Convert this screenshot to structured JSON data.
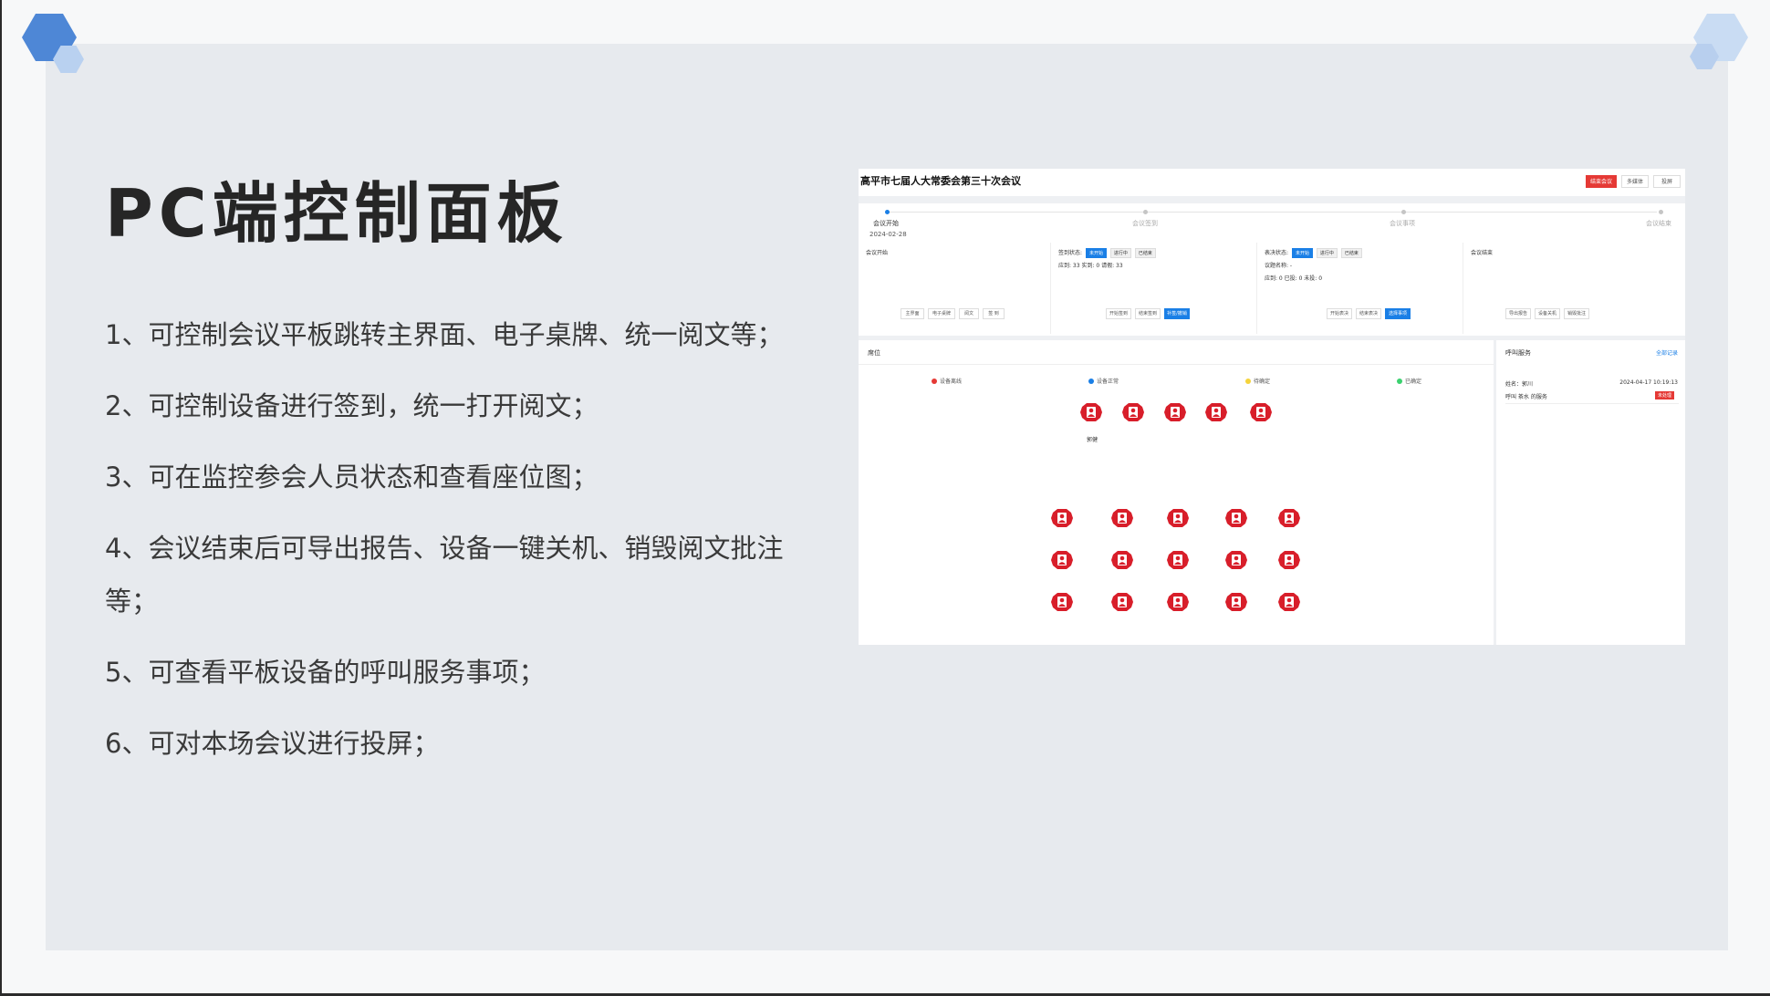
{
  "slide": {
    "title": "PC端控制面板",
    "bullets": [
      "1、可控制会议平板跳转主界面、电子桌牌、统一阅文等；",
      "2、可控制设备进行签到，统一打开阅文；",
      "3、可在监控参会人员状态和查看座位图；",
      "4、会议结束后可导出报告、设备一键关机、销毁阅文批注等；",
      "5、可查看平板设备的呼叫服务事项；",
      "6、可对本场会议进行投屏；"
    ]
  },
  "screenshot": {
    "meeting_title": "高平市七届人大常委会第三十次会议",
    "header_buttons": [
      "结束会议",
      "多媒体",
      "投屏"
    ],
    "steps": [
      {
        "label": "会议开始",
        "active": true
      },
      {
        "label": "会议签到",
        "active": false
      },
      {
        "label": "会议事项",
        "active": false
      },
      {
        "label": "会议结束",
        "active": false
      }
    ],
    "start_date": "2024-02-28",
    "col_start": {
      "title": "会议开始",
      "buttons": [
        "主界面",
        "电子桌牌",
        "阅文",
        "签 到"
      ]
    },
    "col_signin": {
      "status_label": "签到状态:",
      "status_tags": [
        "未开始",
        "进行中",
        "已结束"
      ],
      "stats": "应到: 33   实到: 0   请假: 33",
      "buttons": [
        "开始签到",
        "结束签到",
        "补签/撤销"
      ]
    },
    "col_vote": {
      "status_label": "表决状态:",
      "status_tags": [
        "未开始",
        "进行中",
        "已结束"
      ],
      "topic": "议题名称: -",
      "stats": "应到: 0   已投: 0   未投: 0",
      "buttons": [
        "开始表决",
        "结束表决",
        "选择事项"
      ]
    },
    "col_end": {
      "title": "会议结束",
      "buttons": [
        "导出报告",
        "设备关机",
        "销毁批注"
      ]
    },
    "seat_panel": {
      "title": "席位",
      "legend": [
        {
          "label": "设备离线",
          "color": "#e53935"
        },
        {
          "label": "设备正常",
          "color": "#1a7fe6"
        },
        {
          "label": "待确定",
          "color": "#f5d33b"
        },
        {
          "label": "已确定",
          "color": "#3bd16f"
        }
      ],
      "seat_name": "郭健",
      "seat_color": "#d81e2a"
    },
    "call_panel": {
      "title": "呼叫服务",
      "link": "全部记录",
      "name_row": "姓名：郭川",
      "time": "2024-04-17 10:19:13",
      "call_row": "呼叫 茶水 的服务",
      "badge": "未处理"
    }
  },
  "colors": {
    "accent_blue": "#1a7fe6",
    "accent_red": "#e53935",
    "slide_bg": "#e7eaee"
  }
}
